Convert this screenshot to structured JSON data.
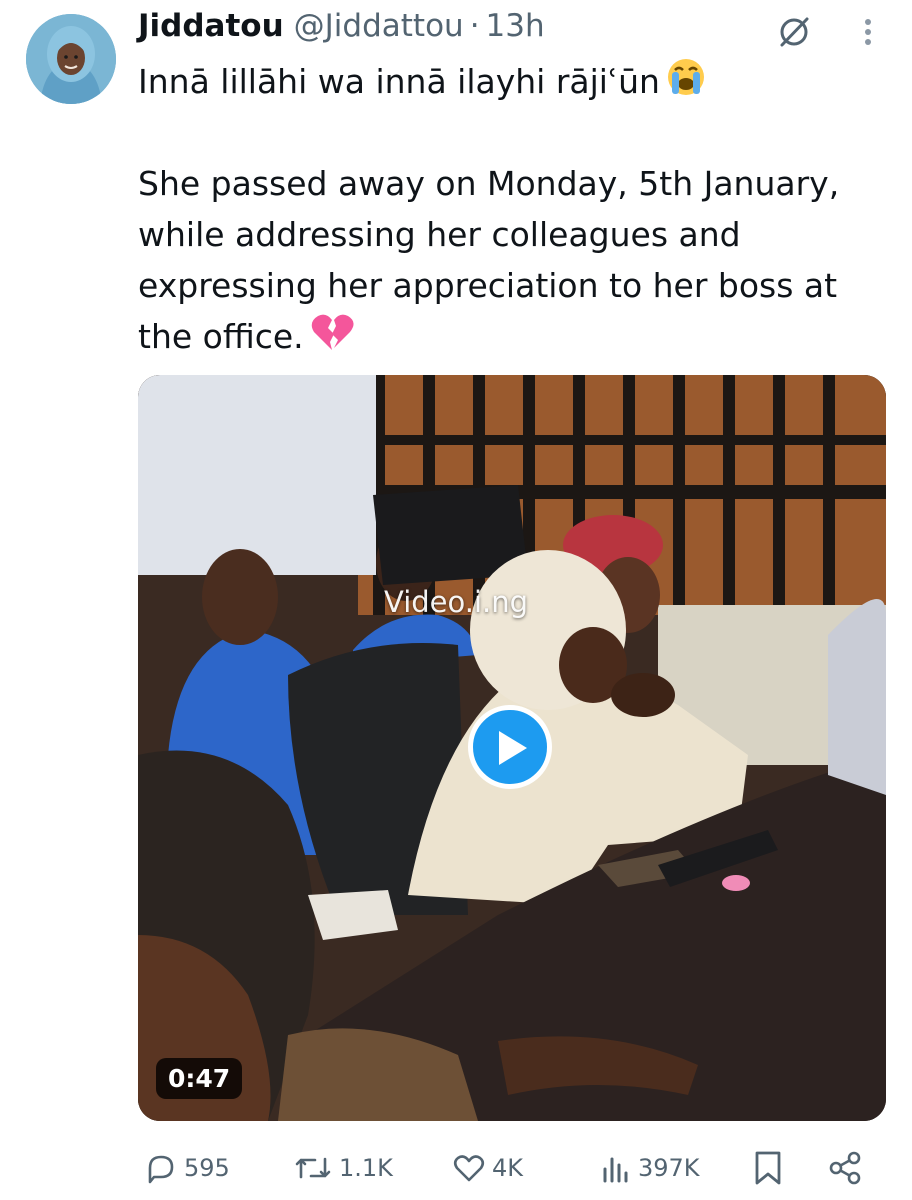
{
  "author": {
    "name": "Jiddatou",
    "handle": "@Jiddattou",
    "separator": "·",
    "time": "13h"
  },
  "tweet": {
    "line1": "Innā lillāhi wa innā ilayhi rājiʿūn",
    "line1_emoji": "loudly-crying-face",
    "body": "She passed away on Monday, 5th January, while addressing her colleagues and expressing her appreciation to her boss at the office.",
    "body_emoji": "broken-heart"
  },
  "media": {
    "watermark": "Video.i.ng",
    "duration": "0:47"
  },
  "actions": {
    "replies": "595",
    "reposts": "1.1K",
    "likes": "4K",
    "views": "397K"
  },
  "colors": {
    "text": "#0f1419",
    "secondary": "#536471",
    "play_button": "#1d9bf0"
  }
}
